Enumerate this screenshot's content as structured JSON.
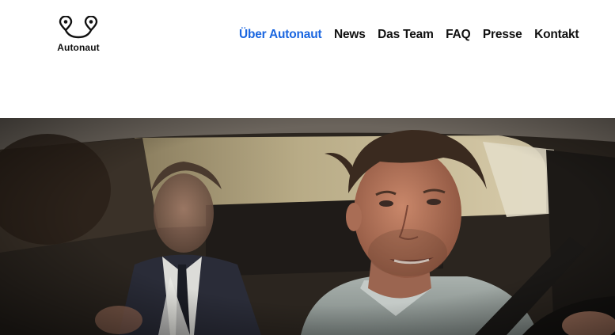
{
  "brand": {
    "name": "Autonaut",
    "logo_icon": "two-map-pins-smile-icon"
  },
  "nav": {
    "items": [
      {
        "label": "Über Autonaut",
        "active": true
      },
      {
        "label": "News",
        "active": false
      },
      {
        "label": "Das Team",
        "active": false
      },
      {
        "label": "FAQ",
        "active": false
      },
      {
        "label": "Presse",
        "active": false
      },
      {
        "label": "Kontakt",
        "active": false
      }
    ]
  },
  "colors": {
    "accent": "#1a66e0",
    "text": "#111111",
    "background": "#ffffff"
  },
  "hero": {
    "image_subject": "car-interior-photo"
  }
}
